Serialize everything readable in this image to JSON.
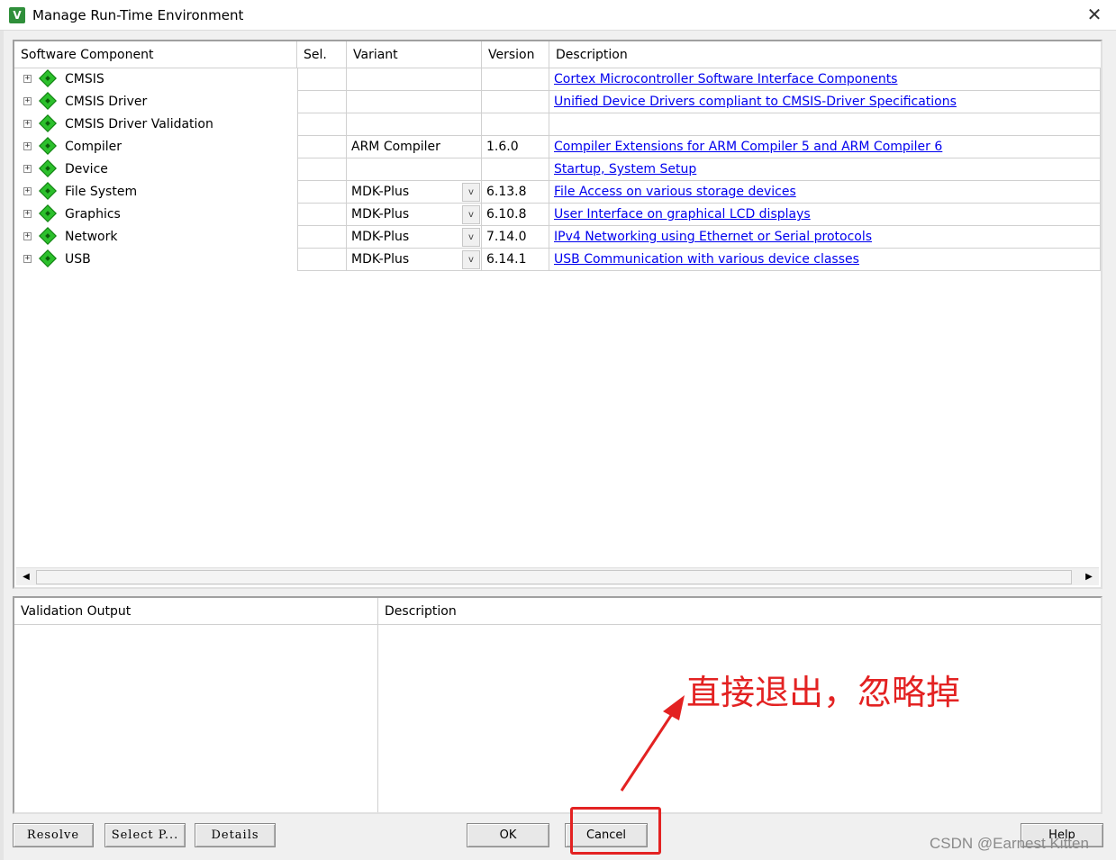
{
  "window": {
    "title": "Manage Run-Time Environment",
    "icon_label": "V",
    "close_glyph": "✕"
  },
  "component_grid": {
    "headers": {
      "component": "Software Component",
      "sel": "Sel.",
      "variant": "Variant",
      "version": "Version",
      "description": "Description"
    },
    "rows": [
      {
        "name": "CMSIS",
        "variant": "",
        "has_dropdown": false,
        "version": "",
        "description": "Cortex Microcontroller Software Interface Components"
      },
      {
        "name": "CMSIS Driver",
        "variant": "",
        "has_dropdown": false,
        "version": "",
        "description": "Unified Device Drivers compliant to CMSIS-Driver Specifications"
      },
      {
        "name": "CMSIS Driver Validation",
        "variant": "",
        "has_dropdown": false,
        "version": "",
        "description": ""
      },
      {
        "name": "Compiler",
        "variant": "ARM Compiler",
        "has_dropdown": false,
        "version": "1.6.0",
        "description": "Compiler Extensions for ARM Compiler 5 and ARM Compiler 6"
      },
      {
        "name": "Device",
        "variant": "",
        "has_dropdown": false,
        "version": "",
        "description": "Startup, System Setup"
      },
      {
        "name": "File System",
        "variant": "MDK-Plus",
        "has_dropdown": true,
        "version": "6.13.8",
        "description": "File Access on various storage devices"
      },
      {
        "name": "Graphics",
        "variant": "MDK-Plus",
        "has_dropdown": true,
        "version": "6.10.8",
        "description": "User Interface on graphical LCD displays"
      },
      {
        "name": "Network",
        "variant": "MDK-Plus",
        "has_dropdown": true,
        "version": "7.14.0",
        "description": "IPv4 Networking using Ethernet or Serial protocols"
      },
      {
        "name": "USB",
        "variant": "MDK-Plus",
        "has_dropdown": true,
        "version": "6.14.1",
        "description": "USB Communication with various device classes"
      }
    ],
    "expander_glyph": "+",
    "dropdown_glyph": "v",
    "scroll_left_glyph": "◀",
    "scroll_right_glyph": "▶"
  },
  "validation": {
    "headers": {
      "output": "Validation Output",
      "description": "Description"
    }
  },
  "buttons": {
    "resolve": "Resolve",
    "select_packs": "Select P...",
    "details": "Details",
    "ok": "OK",
    "cancel": "Cancel",
    "help": "Help"
  },
  "annotation": {
    "text": "直接退出，忽略掉",
    "color": "#e32222"
  },
  "watermark": "CSDN @Earnest Kitten",
  "colors": {
    "link": "#0000ee",
    "component_icon": "#2cc02c"
  }
}
